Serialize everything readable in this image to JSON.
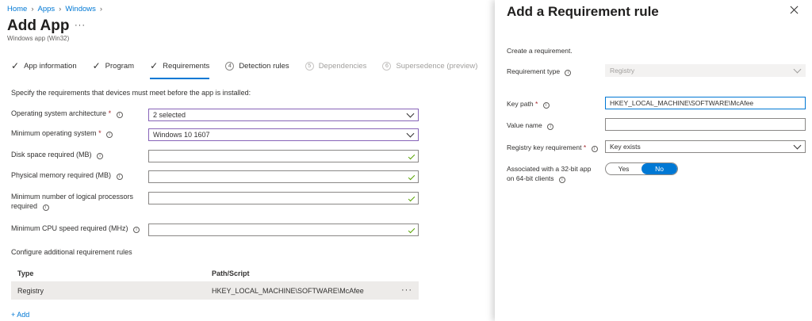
{
  "breadcrumb": {
    "items": [
      "Home",
      "Apps",
      "Windows"
    ]
  },
  "page": {
    "title": "Add App",
    "subtitle": "Windows app (Win32)",
    "more": "···"
  },
  "wizard": {
    "steps": [
      {
        "label": "App information",
        "marker": "✓",
        "state": "done"
      },
      {
        "label": "Program",
        "marker": "✓",
        "state": "done"
      },
      {
        "label": "Requirements",
        "marker": "✓",
        "state": "active"
      },
      {
        "label": "Detection rules",
        "marker": "4",
        "state": "pending"
      },
      {
        "label": "Dependencies",
        "marker": "5",
        "state": "inactive"
      },
      {
        "label": "Supersedence (preview)",
        "marker": "6",
        "state": "inactive"
      }
    ]
  },
  "form": {
    "intro": "Specify the requirements that devices must meet before the app is installed:",
    "os_arch": {
      "label": "Operating system architecture",
      "value": "2 selected"
    },
    "min_os": {
      "label": "Minimum operating system",
      "value": "Windows 10 1607"
    },
    "disk_space": {
      "label": "Disk space required (MB)",
      "value": ""
    },
    "memory": {
      "label": "Physical memory required (MB)",
      "value": ""
    },
    "processors": {
      "label_line1": "Minimum number of logical processors",
      "label_line2": "required",
      "value": ""
    },
    "cpu_speed": {
      "label": "Minimum CPU speed required (MHz)",
      "value": ""
    },
    "required_mark": "*",
    "info_glyph": "i"
  },
  "rules": {
    "title": "Configure additional requirement rules",
    "columns": [
      "Type",
      "Path/Script"
    ],
    "rows": [
      {
        "type": "Registry",
        "path": "HKEY_LOCAL_MACHINE\\SOFTWARE\\McAfee",
        "more": "···"
      }
    ],
    "add_label": "+ Add"
  },
  "panel": {
    "title": "Add a Requirement rule",
    "intro": "Create a requirement.",
    "requirement_type": {
      "label": "Requirement type",
      "value": "Registry"
    },
    "key_path": {
      "label": "Key path",
      "value": "HKEY_LOCAL_MACHINE\\SOFTWARE\\McAfee"
    },
    "value_name": {
      "label": "Value name",
      "value": ""
    },
    "key_requirement": {
      "label": "Registry key requirement",
      "value": "Key exists"
    },
    "assoc": {
      "label_line1": "Associated with a 32-bit app",
      "label_line2": "on 64-bit clients",
      "yes": "Yes",
      "no": "No",
      "selected": "No"
    }
  },
  "colors": {
    "accent": "#0078d4",
    "required": "#a4262c",
    "valid": "#57a300",
    "select_border": "#8764b8"
  }
}
